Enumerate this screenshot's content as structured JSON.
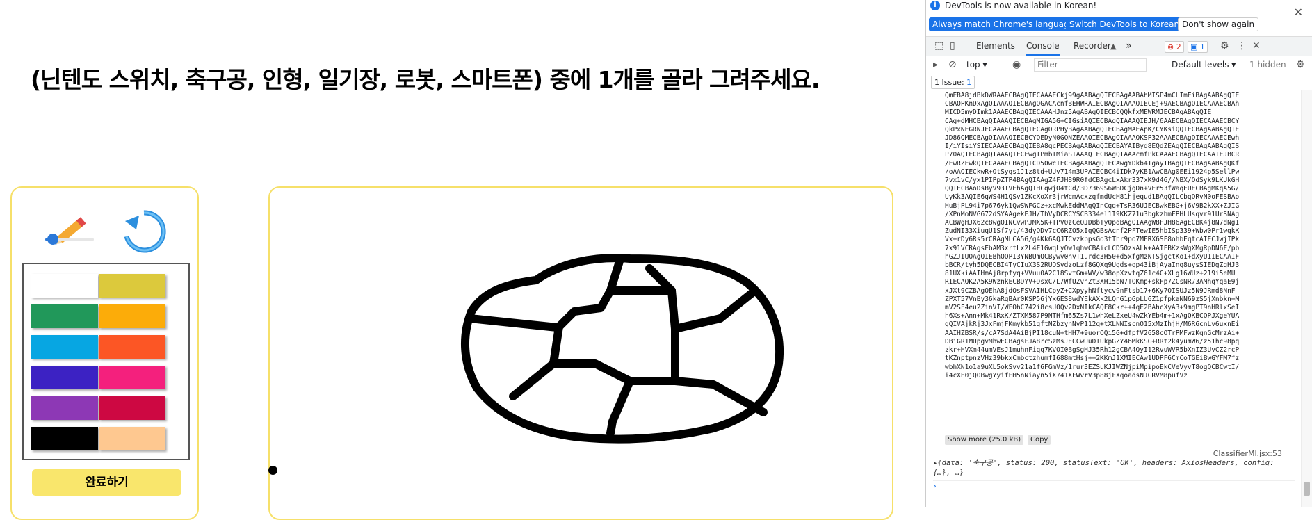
{
  "app": {
    "instruction": "(닌텐도 스위치, 축구공, 인형, 일기장, 로봇, 스마트폰) 중에 1개를 골라 그려주세요.",
    "brush_size_fraction": 0.13,
    "palette": [
      {
        "name": "white",
        "color": "#ffffff"
      },
      {
        "name": "mustard",
        "color": "#dcc93c"
      },
      {
        "name": "green",
        "color": "#21985a"
      },
      {
        "name": "orange",
        "color": "#fcac09"
      },
      {
        "name": "sky-blue",
        "color": "#07a6e2"
      },
      {
        "name": "red-orange",
        "color": "#fc5625"
      },
      {
        "name": "indigo",
        "color": "#3c22c3"
      },
      {
        "name": "pink",
        "color": "#f4207d"
      },
      {
        "name": "purple",
        "color": "#8d38b5"
      },
      {
        "name": "crimson",
        "color": "#cd0842"
      },
      {
        "name": "black",
        "color": "#000000"
      },
      {
        "name": "peach",
        "color": "#fec890"
      }
    ],
    "done_label": "완료하기",
    "accent_color": "#f9e66c"
  },
  "devtools": {
    "infobar_text": "DevTools is now available in Korean!",
    "btn_match": "Always match Chrome's language",
    "btn_switch": "Switch DevTools to Korean",
    "btn_dont_show": "Don't show again",
    "tabs": [
      "Elements",
      "Console",
      "Recorder"
    ],
    "active_tab": "Console",
    "tabs_more": "»",
    "error_count": "2",
    "message_count": "1",
    "context": "top",
    "filter_placeholder": "Filter",
    "levels": "Default levels",
    "hidden": "1 hidden",
    "issue_label": "1 Issue:",
    "issue_count": "1",
    "log_lines": [
      "QmEBA8jdBkDWRAAECBAgQIECAAAECkj99gAABAgQIECBAgAABAhMISP4mCLImEiBAgAABAgQIE",
      "CBAQPKnDxAgQIAAAQIECBAgQGACAcnfBEHWRAIECBAgQIAAAQIECEj+9AECBAgQIECAAAECBAh",
      "MICD5myDImk1AAAECBAgQIECAAAHJnz5AgABAgQIECBCQQkfxMEWRMJECBAgABAgQIE",
      "CAg+dMHCBAgQIAAAQIECBAgMIGA5G+CIGsiAQIECBAgQIAAAQIEJH/6AAECBAgQIECAAAECBCY",
      "QkPxNEGRNJECAAAECBAgQIECAgORPHyBAgAABAgQIECBAgMAEApK/CYKsiQQIECBAgAABAgQIE",
      "JD86QMECBAgQIAAAQIECBCYQEDyN0GQNZEAAQIECBAgQIAAAQKSP32AAAECBAgQIECAAAECEwh",
      "I/iYIsiYSIECAAAECBAgQIEBA8qcPECBAgAABAgQIECBAYAIByd8EQdZEAgQIECBAgAABAgQIS",
      "P70AQIECBAgQIAAAQIECEwgIPmbIMiaSIAAAQIECBAgQIAAAcmfPkCAAAECBAgQIECAAIEJBCR",
      "/EwRZEwkQIECAAAECBAgQICD50wcIECBAgAABAgQIECAwgYDkb4IgayIBAgQIECBAgAABAgQKf",
      "/oAAQIECkwR+OtSyqs1J1z8td+UUv714m3UPAIECBC4iIDk7yKB1AwCBAg0EEi1924p5SellPw",
      "7vx1vC/yx1PIPpZTP4BAgQIAAgZ4FJH89R0fdCBAgcLxAkr337xK9d46//NBX/OdSyk9LKUkGH",
      "QQIECBAoDsByV93IVEhAgQIHCqwjO4tCd/3D7369S6WBDCjgDn+VEr53fWaqEUECBAgMKqA5G/",
      "UyKk3AQIE6gWS4H1QSv1ZKcXoXr3jrWcmAcxzgfmdUcH81hjequd1BAgQILCbgORvN0oFESBAo",
      "HuBjPL94i7p676yk1QwSWFGCz+xcMwkEddMAgQInCgg+TsR36UJECBwkEBG+j6V9B2kXX+ZJIG",
      "/XPnMoNVG672dSYAAgekEJH/ThVyDCRCYSCB334el1I9KKZ71u3bgkzhmFPHLUsqvr91UrSNAg",
      "ACBWgHJX62c8wgQINCvwPJMX5K+TPV0zCeQJDBbTyQpdBAgQIAAgW8FJH86AgECBK4j8N7dNg1",
      "ZudNI33XiuqU1Sf7yt/43dyODv7cC6RZO5xIgQGBsAcnf2PFTewIE5hbISp339+Wbw0Pr1wgkK",
      "Vx+rDy6Rs5rCRAgMLCA5G/g4Kk6AQJTCvzkbpsGo3tThr9po7MFRX6SF8ohbEqtcAIECJwjIPk",
      "7x91VCRAgsEbAM3xrtLx2L4F1GwqLyOw1qhwCBAicLCD5OzkALk+AAIFBKzsWgXMgRpDN6F/pb",
      "hGZJIUOAgQIEBhQQPI3YNBUmQCBywv0nvT1urdc3H50+d5xfgMzNTSjgctKo1+dXyU1IECAAIF",
      "bBCR/tyh5DQECBI4TyCIuX3S2RUOSvdzoLzf8GQXq9Ugds+qp43iBjAyaInq8uysSIEDgZgHJ3",
      "81UXkiAAIHmAj8rpfyq+VVuu0A2C18SvtGm+WV/w38opXzvtqZ61c4C+XLg16WUz+219i5eMU",
      "RIECAQK2A5K9WznkECBDYV+DsxC/L/WfUZvnZt3XH15bN7TOKmp+skFp7ZCsNR73AMhqYqaE9j",
      "xJXt9CZBAgQEhA8jdQsFSVAIHLCpyZ+CXpyyhNftycv9nFtsb17+6Ky7OISUJz5N9JRmd8NnF",
      "ZPXT57VnBy36kaRgBAr0KSP56jYx6ES8wdYEkAXk2LQnG1pGpLU6Z1pfpkaNN69zS5jXnbkn+M",
      "mV2SF4eu2ZinVI/WFOhC742i8csU0Qv2DxNIkCAQF8Ckr++4qE2BAhcXyA3+9mgPT9nHRlxSeI",
      "h6Xs+Ann+Mk41RxK/ZTXM587P9NTHfm65Zs7L1whXeLZxeU4wZkYEb4m+1xAgQKBCQPJXgeYUA",
      "gQIVAjkRj3JxFmjFKmykb51gftNZbzynNvP112q+tXLNNIscnO15xMzIhjH/M6R6cnLv6uxnEi",
      "AAIHZBSR/s/cA7SdA4AiBjPI18cuN+tHH7+9uorOQi5G+dfpfV2658cOTrPMFwzKqnGcMrzAi+",
      "DBiGR1MUpgvMhwECBAgsFJA8rcSzMsJECCwUuDTUkpGZY46MkKSG+RRt2k4yumW6/z51hc98pq",
      "zkr+HVXm44umVEsJ1muhnFiqq7KVOI0BgSgHJ35Rh12gCBA4QyI12RvuWVR5bXnIZ3UvCZ2rcP",
      "tKZnptpnzVHz39bkxCmbctzhumfI688mtHsj++2KKmJ1XMIECAw1UDPF6CmCoTGEiBwGYFM7fz",
      "wbhXN1o1a9uXL5okSvv21a1f6FGmVz/1rur3EZSuKJIWZNjpiMpipoEkCVeVyvT8ogQCBCwtI/",
      "i4cXE0jQOBwgYyifFH5nNiayn5iX741XFWvrV3p88jFXqoadsNJGRVM8pufVz"
    ],
    "show_more": "Show more (25.0 kB)",
    "copy": "Copy",
    "source": "ClassifierMl.jsx:53",
    "object_line": "▸{data: '축구공', status: 200, statusText: 'OK', headers: AxiosHeaders, config: {…}, …}",
    "prompt_symbol": "›"
  }
}
